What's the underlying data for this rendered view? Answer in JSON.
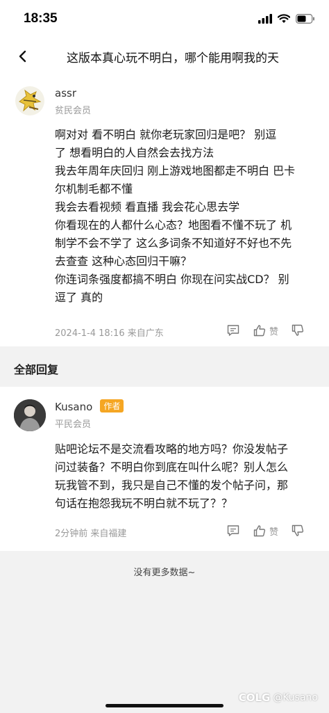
{
  "status": {
    "time": "18:35"
  },
  "nav": {
    "title": "这版本真心玩不明白，哪个能用啊我的天"
  },
  "post": {
    "username": "assr",
    "rank": "贫民会员",
    "lines": [
      "啊对对 看不明白 就你老玩家回归是吧？ 别逗",
      "了 想看明白的人自然会去找方法",
      "我去年周年庆回归 刚上游戏地图都走不明白 巴卡",
      "尔机制毛都不懂",
      "我会去看视频 看直播  我会花心思去学",
      "你看现在的人都什么心态？地图看不懂不玩了  机",
      "制学不会不学了  这么多词条不知道好不好也不先",
      "去查查  这种心态回归干嘛？",
      "你连词条强度都搞不明白 你现在问实战CD？ 别",
      "逗了 真的"
    ],
    "meta": "2024-1-4 18:16  来自广东",
    "like_label": "赞"
  },
  "section": {
    "title": "全部回复"
  },
  "reply": {
    "username": "Kusano",
    "author_tag": "作者",
    "rank": "平民会员",
    "lines": [
      "贴吧论坛不是交流看攻略的地方吗？你没发帖子",
      "问过装备？不明白你到底在叫什么呢？别人怎么",
      "玩我管不到，我只是自己不懂的发个帖子问，那",
      "句话在抱怨我玩不明白就不玩了？？"
    ],
    "meta": "2分钟前 来自福建",
    "like_label": "赞"
  },
  "footer": {
    "no_more": "没有更多数据~"
  },
  "watermark": {
    "logo": "COLG",
    "handle": "@Kusano"
  },
  "icons": {
    "back": "chevron-left-icon",
    "comment": "comment-icon",
    "like": "thumbs-up-icon",
    "dislike": "thumbs-down-icon"
  },
  "colors": {
    "author_tag": "#f5a623",
    "background": "#f2f2f2"
  }
}
